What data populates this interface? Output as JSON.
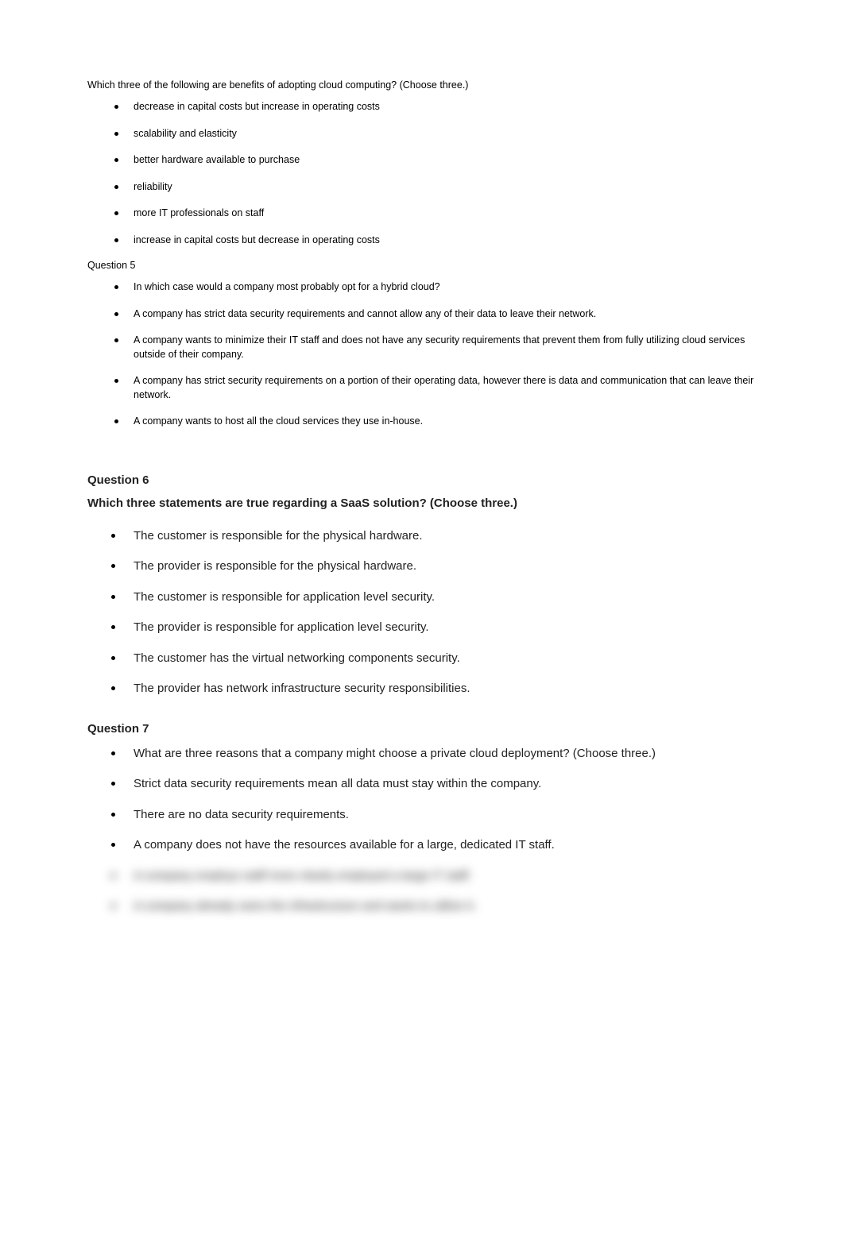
{
  "q4": {
    "intro": "Which three of the following are benefits of adopting cloud computing? (Choose three.)",
    "options": [
      "decrease in capital costs but increase in operating costs",
      "scalability and elasticity",
      "better hardware available to purchase",
      "reliability",
      "more IT professionals on staff",
      "increase in capital costs but decrease in operating costs"
    ]
  },
  "q5": {
    "label": "Question 5",
    "options": [
      "In which case would a company most probably opt for a hybrid cloud?",
      "A company has strict data security requirements and cannot allow any of their data to leave their network.",
      "A company wants to minimize their IT staff and does not have any security requirements that prevent them from fully utilizing cloud services outside of their company.",
      "A company has strict security requirements on a portion of their operating data, however there is data and communication that can leave their network.",
      "A company wants to host all the cloud services they use in-house."
    ]
  },
  "q6": {
    "label": "Question 6",
    "intro": "Which three statements are true regarding a SaaS solution? (Choose three.)",
    "options": [
      "The customer is responsible for the physical hardware.",
      "The provider is responsible for the physical hardware.",
      "The customer is responsible for application level security.",
      "The provider is responsible for application level security.",
      "The customer has the virtual networking components security.",
      "The provider has network infrastructure security responsibilities."
    ]
  },
  "q7": {
    "label": "Question 7",
    "options": [
      "What are three reasons that a company might choose a private cloud deployment? (Choose three.)",
      "Strict data security requirements mean all data must stay within the company.",
      "There are no data security requirements.",
      "A company does not have the resources available for a large, dedicated IT staff."
    ],
    "hidden": [
      "A company employs staff more clearly employed a large IT staff.",
      "A company already owns the infrastructure and wants to utilize it."
    ]
  }
}
